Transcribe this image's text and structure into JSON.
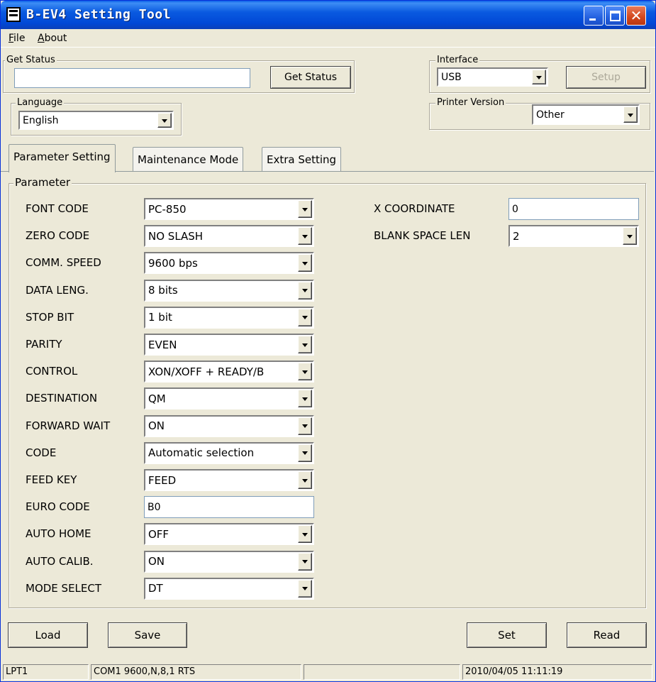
{
  "window": {
    "title": "B-EV4 Setting Tool"
  },
  "menu": {
    "file": "File",
    "about": "About"
  },
  "get_status": {
    "legend": "Get Status",
    "value": "",
    "button": "Get Status"
  },
  "interface": {
    "legend": "Interface",
    "selected": "USB",
    "setup_button": "Setup"
  },
  "language": {
    "legend": "Language",
    "selected": "English"
  },
  "printer_version": {
    "legend": "Printer Version",
    "selected": "Other"
  },
  "tabs": [
    {
      "label": "Parameter Setting",
      "active": true
    },
    {
      "label": "Maintenance Mode",
      "active": false
    },
    {
      "label": "Extra Setting",
      "active": false
    }
  ],
  "parameter": {
    "legend": "Parameter",
    "left": [
      {
        "label": "FONT CODE",
        "value": "PC-850",
        "type": "combo"
      },
      {
        "label": "ZERO CODE",
        "value": "NO SLASH",
        "type": "combo"
      },
      {
        "label": "COMM. SPEED",
        "value": "9600 bps",
        "type": "combo"
      },
      {
        "label": "DATA LENG.",
        "value": "8 bits",
        "type": "combo"
      },
      {
        "label": "STOP BIT",
        "value": "1 bit",
        "type": "combo"
      },
      {
        "label": "PARITY",
        "value": "EVEN",
        "type": "combo"
      },
      {
        "label": "CONTROL",
        "value": "XON/XOFF + READY/B",
        "type": "combo"
      },
      {
        "label": "DESTINATION",
        "value": "QM",
        "type": "combo"
      },
      {
        "label": "FORWARD WAIT",
        "value": "ON",
        "type": "combo"
      },
      {
        "label": "CODE",
        "value": "Automatic selection",
        "type": "combo"
      },
      {
        "label": "FEED KEY",
        "value": "FEED",
        "type": "combo"
      },
      {
        "label": "EURO CODE",
        "value": "B0",
        "type": "text"
      },
      {
        "label": "AUTO HOME",
        "value": "OFF",
        "type": "combo"
      },
      {
        "label": "AUTO CALIB.",
        "value": "ON",
        "type": "combo"
      },
      {
        "label": "MODE SELECT",
        "value": "DT",
        "type": "combo"
      }
    ],
    "right": [
      {
        "label": "X COORDINATE",
        "value": "0",
        "type": "text"
      },
      {
        "label": "BLANK SPACE LEN",
        "value": "2",
        "type": "combo"
      }
    ]
  },
  "buttons": {
    "load": "Load",
    "save": "Save",
    "set": "Set",
    "read": "Read"
  },
  "statusbar": {
    "port": "LPT1",
    "com": "COM1 9600,N,8,1 RTS",
    "blank": "",
    "datetime": "2010/04/05 11:11:19"
  }
}
